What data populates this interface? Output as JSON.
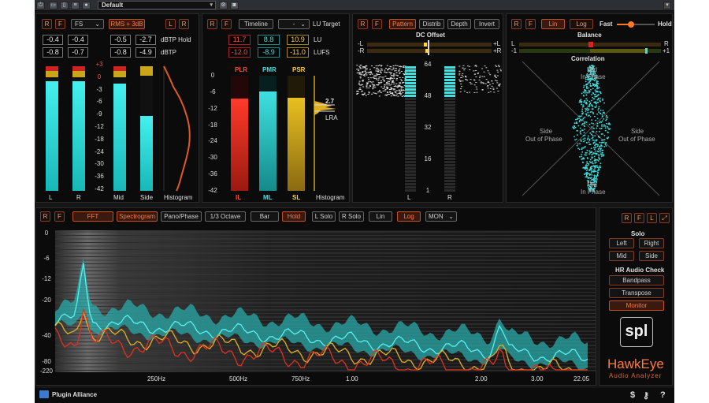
{
  "host": {
    "preset": "Default"
  },
  "level": {
    "rb_r": "R",
    "rb_f": "F",
    "mode": "FS",
    "rms": "RMS + 3dB",
    "btn_l": "L",
    "btn_r": "R",
    "peak_hold": [
      "-0.4",
      "-0.4",
      "-0.5",
      "-2.7"
    ],
    "dbtp": [
      "-0.8",
      "-0.7",
      "-0.8",
      "-4.9"
    ],
    "peak_hold_label": "dBTP Hold",
    "dbtp_label": "dBTP",
    "scale": [
      "+3",
      "0",
      "-3",
      "-6",
      "-9",
      "-12",
      "-18",
      "-24",
      "-30",
      "-36",
      "-42"
    ],
    "labels": [
      "L",
      "R",
      "Mid",
      "Side",
      "Histogram"
    ],
    "meters": [
      0.88,
      0.88,
      0.86,
      0.6
    ]
  },
  "lu": {
    "rb_r": "R",
    "rb_f": "F",
    "timeline": "Timeline",
    "target": "-",
    "target_label": "LU Target",
    "lu_vals": [
      "11.7",
      "8.8",
      "10.9"
    ],
    "lufs_vals": [
      "-12.0",
      "-8.9",
      "-11.0"
    ],
    "lu_label": "LU",
    "lufs_label": "LUFS",
    "bar_titles": [
      "PLR",
      "PMR",
      "PSR"
    ],
    "bar_labels": [
      "IL",
      "ML",
      "SL"
    ],
    "scale": [
      "0",
      "-6",
      "-12",
      "-18",
      "-24",
      "-30",
      "-36",
      "-42"
    ],
    "lra_value": "2.7",
    "lra_label": "LRA",
    "histogram": "Histogram",
    "bars": [
      0.8,
      0.86,
      0.81
    ]
  },
  "dc": {
    "rb_r": "R",
    "rb_f": "F",
    "pattern": "Pattern",
    "distrib": "Distrib",
    "depth": "Depth",
    "invert": "Invert",
    "title": "DC Offset",
    "minus_l": "-L",
    "minus_r": "-R",
    "plus_l": "+L",
    "plus_r": "+R",
    "scale": [
      "64",
      "48",
      "32",
      "16",
      "1"
    ],
    "labels": [
      "L",
      "R"
    ]
  },
  "corr": {
    "rb_r": "R",
    "rb_f": "F",
    "lin": "Lin",
    "log": "Log",
    "fast": "Fast",
    "hold": "Hold",
    "balance": "Balance",
    "l": "L",
    "r": "R",
    "minus1": "-1",
    "plus1": "+1",
    "correlation": "Correlation",
    "mid_top": "Mid",
    "in_phase_top": "In Phase",
    "side_left": "Side",
    "out_left": "Out of Phase",
    "side_right": "Side",
    "out_right": "Out of Phase",
    "mid_bot": "Mid",
    "in_phase_bot": "In Phase"
  },
  "spectrum": {
    "rb_r": "R",
    "rb_f": "F",
    "fft": "FFT",
    "spectrogram": "Spectrogram",
    "pano": "Pano/Phase",
    "octave": "1/3 Octave",
    "bar": "Bar",
    "hold": "Hold",
    "lsolo": "L Solo",
    "rsolo": "R Solo",
    "lin": "Lin",
    "log": "Log",
    "mon": "MON",
    "y_labels": [
      "0",
      "-6",
      "-12",
      "-20",
      "-40",
      "-80",
      "-220"
    ],
    "x_labels": [
      "250Hz",
      "500Hz",
      "750Hz",
      "1.00",
      "2.00",
      "3.00",
      "22.05"
    ]
  },
  "side": {
    "rb_r": "R",
    "rb_f": "F",
    "rb_l": "L",
    "solo": "Solo",
    "left": "Left",
    "right": "Right",
    "mid": "Mid",
    "sideb": "Side",
    "hr_title": "HR Audio Check",
    "bandpass": "Bandpass",
    "transpose": "Transpose",
    "monitor": "Monitor",
    "logo": "spl",
    "product": "HawkEye",
    "subtitle": "Audio Analyzer"
  },
  "footer": {
    "brand": "Plugin Alliance",
    "dollar": "$",
    "help": "?"
  },
  "colors": {
    "accent_orange": "#ff7a40",
    "cyan": "#3fe0e0",
    "red": "#e03020",
    "yellow": "#e0b020"
  }
}
